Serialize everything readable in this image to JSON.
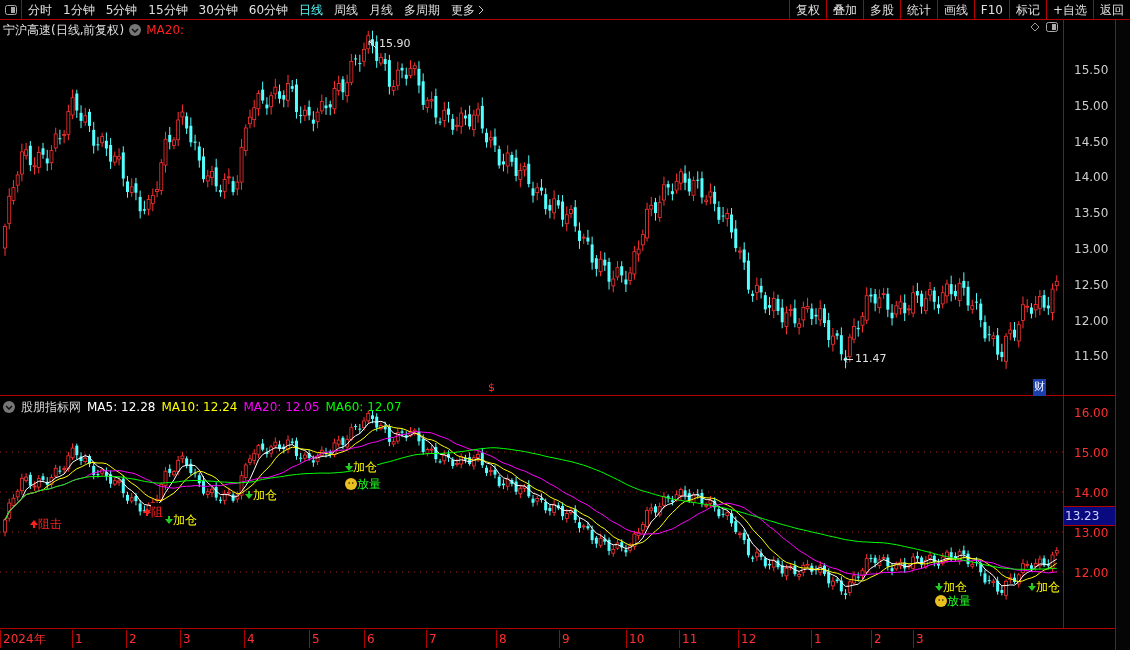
{
  "toolbar": {
    "periods": [
      {
        "label": "分时",
        "selected": false
      },
      {
        "label": "1分钟",
        "selected": false
      },
      {
        "label": "5分钟",
        "selected": false
      },
      {
        "label": "15分钟",
        "selected": false
      },
      {
        "label": "30分钟",
        "selected": false
      },
      {
        "label": "60分钟",
        "selected": false
      },
      {
        "label": "日线",
        "selected": true
      },
      {
        "label": "周线",
        "selected": false
      },
      {
        "label": "月线",
        "selected": false
      },
      {
        "label": "多周期",
        "selected": false
      },
      {
        "label": "更多",
        "selected": false
      }
    ],
    "buttons": [
      "复权",
      "叠加",
      "多股",
      "统计",
      "画线",
      "F10",
      "标记",
      "+自选",
      "返回"
    ]
  },
  "main_chart": {
    "title": "宁沪高速(日线,前复权)",
    "indicator": "MA20:",
    "y_axis": [
      "15.50",
      "15.00",
      "14.50",
      "14.00",
      "13.50",
      "13.00",
      "12.50",
      "12.00",
      "11.50"
    ],
    "max_label": "15.90",
    "min_label": "11.47",
    "markers": [
      {
        "kind": "event",
        "text": "$"
      },
      {
        "kind": "finance",
        "text": "财"
      }
    ]
  },
  "indicator_panel": {
    "name": "股朋指标网",
    "legend": [
      {
        "label": "MA5: 12.28",
        "color": "#ffffff"
      },
      {
        "label": "MA10: 12.24",
        "color": "#ffff00"
      },
      {
        "label": "MA20: 12.05",
        "color": "#ff00ff"
      },
      {
        "label": "MA60: 12.07",
        "color": "#00ff00"
      }
    ],
    "y_axis": [
      "16.00",
      "15.00",
      "14.00",
      "13.00",
      "12.00"
    ],
    "current_price": "13.23",
    "signals": [
      {
        "kind": "resist",
        "text": "阻击"
      },
      {
        "kind": "resist",
        "text": "阻"
      },
      {
        "kind": "add",
        "text": "加仓"
      },
      {
        "kind": "add",
        "text": "加仓"
      },
      {
        "kind": "add",
        "text": "加仓"
      },
      {
        "kind": "volume",
        "text": "放量"
      },
      {
        "kind": "add",
        "text": "加仓"
      },
      {
        "kind": "volume",
        "text": "放量"
      },
      {
        "kind": "add",
        "text": "加仓"
      }
    ]
  },
  "date_axis": [
    "2024年",
    "1",
    "2",
    "3",
    "4",
    "5",
    "6",
    "7",
    "8",
    "9",
    "10",
    "11",
    "12",
    "1",
    "2",
    "3"
  ]
}
